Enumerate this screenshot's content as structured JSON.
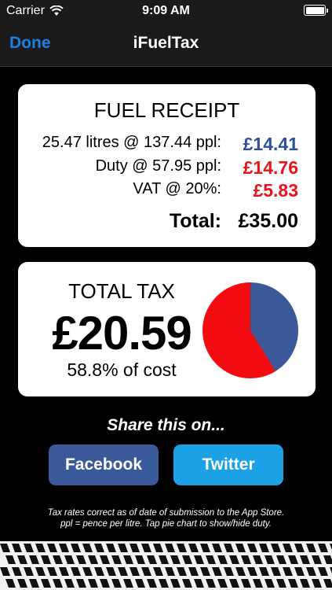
{
  "status_bar": {
    "carrier": "Carrier",
    "time": "9:09 AM"
  },
  "nav": {
    "done_label": "Done",
    "title": "iFuelTax"
  },
  "receipt": {
    "heading": "FUEL RECEIPT",
    "lines": [
      {
        "label": "25.47 litres @ 137.44 ppl:",
        "value": "£14.41",
        "color": "#2f4f9e"
      },
      {
        "label": "Duty @ 57.95 ppl:",
        "value": "£14.76",
        "color": "#e8141b"
      },
      {
        "label": "VAT @ 20%:",
        "value": "£5.83",
        "color": "#e8141b"
      }
    ],
    "total_label": "Total:",
    "total_value": "£35.00"
  },
  "tax": {
    "heading": "TOTAL TAX",
    "amount": "£20.59",
    "percent_text": "58.8% of cost",
    "pie": [
      {
        "part": "fuel",
        "amount": 14.41,
        "color": "#3b5998"
      },
      {
        "part": "duty",
        "amount": 14.76,
        "color": "#f20c12"
      },
      {
        "part": "vat",
        "amount": 5.83,
        "color": "#f20c12"
      }
    ]
  },
  "share": {
    "title": "Share this on...",
    "facebook_label": "Facebook",
    "twitter_label": "Twitter"
  },
  "footnote": {
    "line1": "Tax rates correct as of date of submission to the App Store.",
    "line2": "ppl = pence per litre. Tap pie chart to show/hide duty."
  },
  "colors": {
    "accent": "#1a7fe5",
    "facebook": "#3a5998",
    "twitter": "#1da1e6",
    "red": "#e8141b",
    "blue": "#2f4f9e"
  }
}
